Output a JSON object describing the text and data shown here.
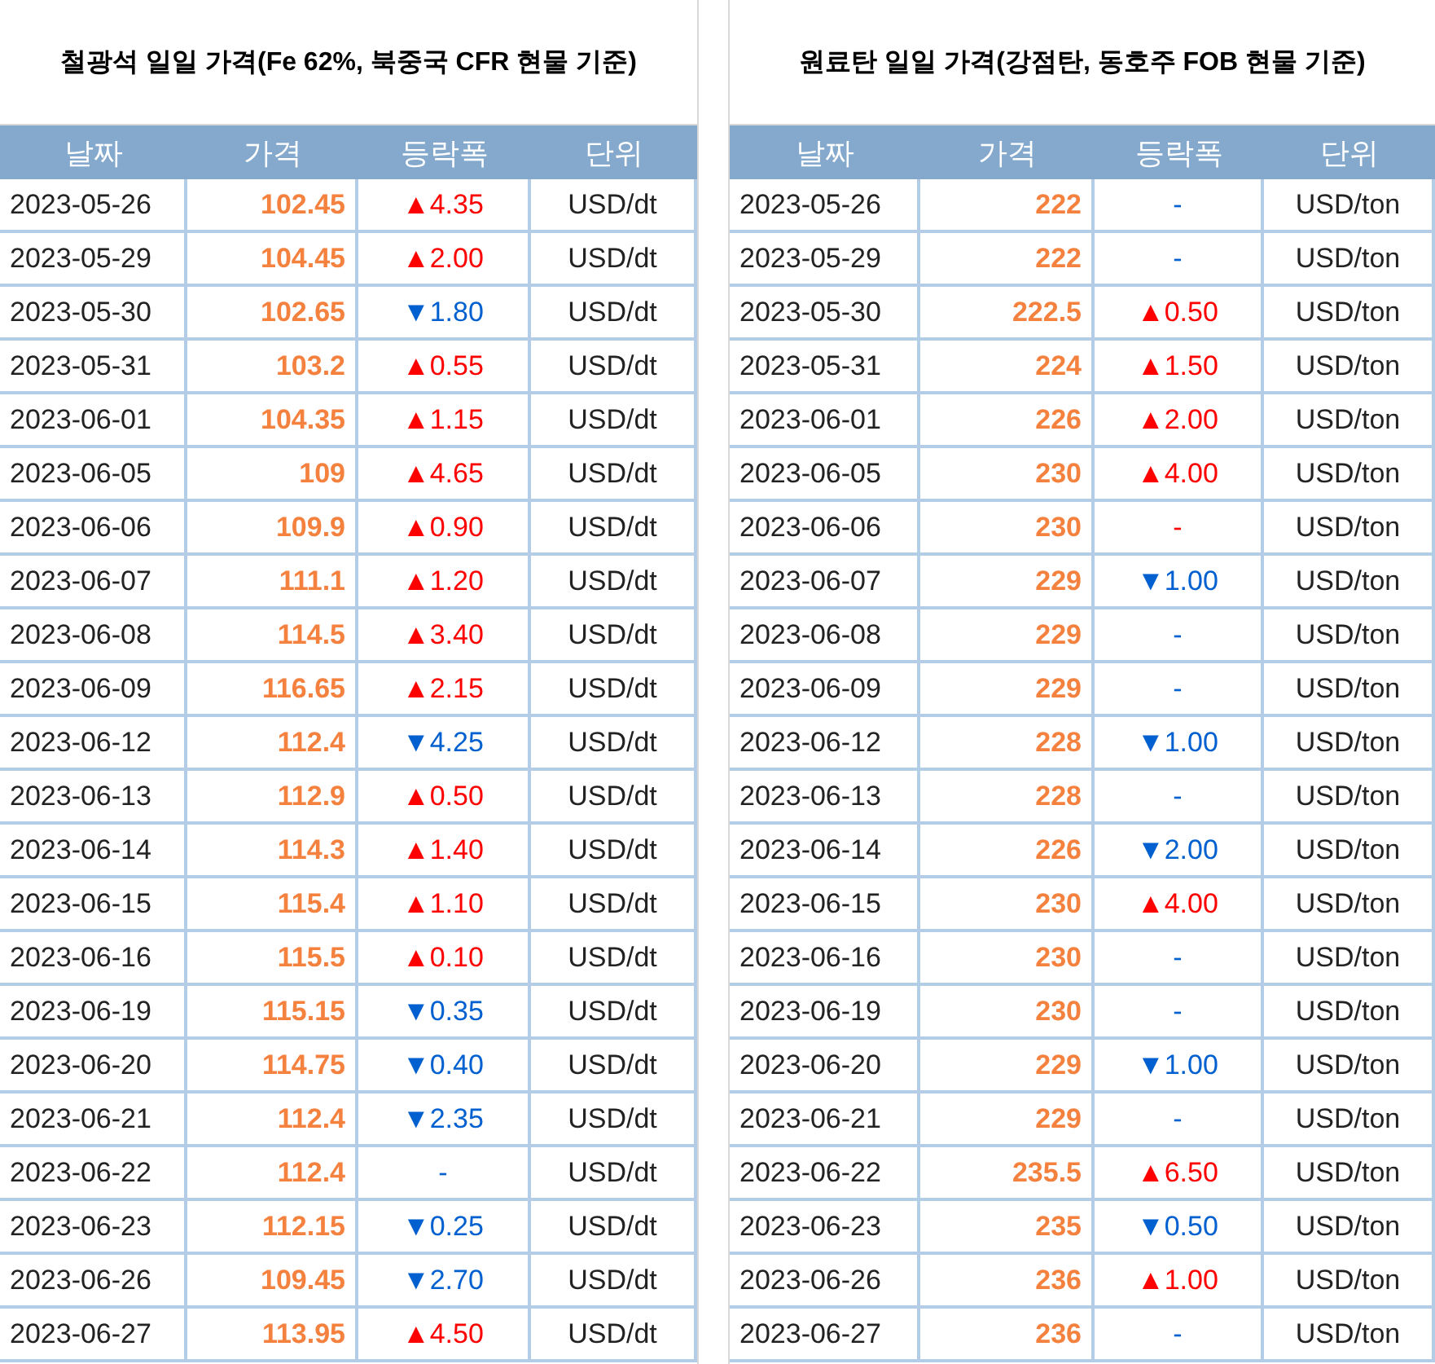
{
  "tables": [
    {
      "title": "철광석 일일 가격(Fe 62%, 북중국 CFR 현물 기준)",
      "columns": [
        "날짜",
        "가격",
        "등락폭",
        "단위"
      ],
      "rows": [
        {
          "date": "2023-05-26",
          "price": "102.45",
          "change": "▲4.35",
          "color": "#ff0000",
          "unit": "USD/dt"
        },
        {
          "date": "2023-05-29",
          "price": "104.45",
          "change": "▲2.00",
          "color": "#ff0000",
          "unit": "USD/dt"
        },
        {
          "date": "2023-05-30",
          "price": "102.65",
          "change": "▼1.80",
          "color": "#0060d0",
          "unit": "USD/dt"
        },
        {
          "date": "2023-05-31",
          "price": "103.2",
          "change": "▲0.55",
          "color": "#ff0000",
          "unit": "USD/dt"
        },
        {
          "date": "2023-06-01",
          "price": "104.35",
          "change": "▲1.15",
          "color": "#ff0000",
          "unit": "USD/dt"
        },
        {
          "date": "2023-06-05",
          "price": "109",
          "change": "▲4.65",
          "color": "#ff0000",
          "unit": "USD/dt"
        },
        {
          "date": "2023-06-06",
          "price": "109.9",
          "change": "▲0.90",
          "color": "#ff0000",
          "unit": "USD/dt"
        },
        {
          "date": "2023-06-07",
          "price": "111.1",
          "change": "▲1.20",
          "color": "#ff0000",
          "unit": "USD/dt"
        },
        {
          "date": "2023-06-08",
          "price": "114.5",
          "change": "▲3.40",
          "color": "#ff0000",
          "unit": "USD/dt"
        },
        {
          "date": "2023-06-09",
          "price": "116.65",
          "change": "▲2.15",
          "color": "#ff0000",
          "unit": "USD/dt"
        },
        {
          "date": "2023-06-12",
          "price": "112.4",
          "change": "▼4.25",
          "color": "#0060d0",
          "unit": "USD/dt"
        },
        {
          "date": "2023-06-13",
          "price": "112.9",
          "change": "▲0.50",
          "color": "#ff0000",
          "unit": "USD/dt"
        },
        {
          "date": "2023-06-14",
          "price": "114.3",
          "change": "▲1.40",
          "color": "#ff0000",
          "unit": "USD/dt"
        },
        {
          "date": "2023-06-15",
          "price": "115.4",
          "change": "▲1.10",
          "color": "#ff0000",
          "unit": "USD/dt"
        },
        {
          "date": "2023-06-16",
          "price": "115.5",
          "change": "▲0.10",
          "color": "#ff0000",
          "unit": "USD/dt"
        },
        {
          "date": "2023-06-19",
          "price": "115.15",
          "change": "▼0.35",
          "color": "#0060d0",
          "unit": "USD/dt"
        },
        {
          "date": "2023-06-20",
          "price": "114.75",
          "change": "▼0.40",
          "color": "#0060d0",
          "unit": "USD/dt"
        },
        {
          "date": "2023-06-21",
          "price": "112.4",
          "change": "▼2.35",
          "color": "#0060d0",
          "unit": "USD/dt"
        },
        {
          "date": "2023-06-22",
          "price": "112.4",
          "change": "-",
          "color": "#0060d0",
          "unit": "USD/dt"
        },
        {
          "date": "2023-06-23",
          "price": "112.15",
          "change": "▼0.25",
          "color": "#0060d0",
          "unit": "USD/dt"
        },
        {
          "date": "2023-06-26",
          "price": "109.45",
          "change": "▼2.70",
          "color": "#0060d0",
          "unit": "USD/dt"
        },
        {
          "date": "2023-06-27",
          "price": "113.95",
          "change": "▲4.50",
          "color": "#ff0000",
          "unit": "USD/dt"
        }
      ]
    },
    {
      "title": "원료탄 일일 가격(강점탄, 동호주 FOB 현물 기준)",
      "columns": [
        "날짜",
        "가격",
        "등락폭",
        "단위"
      ],
      "rows": [
        {
          "date": "2023-05-26",
          "price": "222",
          "change": "-",
          "color": "#0060d0",
          "unit": "USD/ton"
        },
        {
          "date": "2023-05-29",
          "price": "222",
          "change": "-",
          "color": "#0060d0",
          "unit": "USD/ton"
        },
        {
          "date": "2023-05-30",
          "price": "222.5",
          "change": "▲0.50",
          "color": "#ff0000",
          "unit": "USD/ton"
        },
        {
          "date": "2023-05-31",
          "price": "224",
          "change": "▲1.50",
          "color": "#ff0000",
          "unit": "USD/ton"
        },
        {
          "date": "2023-06-01",
          "price": "226",
          "change": "▲2.00",
          "color": "#ff0000",
          "unit": "USD/ton"
        },
        {
          "date": "2023-06-05",
          "price": "230",
          "change": "▲4.00",
          "color": "#ff0000",
          "unit": "USD/ton"
        },
        {
          "date": "2023-06-06",
          "price": "230",
          "change": "-",
          "color": "#ff0000",
          "unit": "USD/ton"
        },
        {
          "date": "2023-06-07",
          "price": "229",
          "change": "▼1.00",
          "color": "#0060d0",
          "unit": "USD/ton"
        },
        {
          "date": "2023-06-08",
          "price": "229",
          "change": "-",
          "color": "#0060d0",
          "unit": "USD/ton"
        },
        {
          "date": "2023-06-09",
          "price": "229",
          "change": "-",
          "color": "#0060d0",
          "unit": "USD/ton"
        },
        {
          "date": "2023-06-12",
          "price": "228",
          "change": "▼1.00",
          "color": "#0060d0",
          "unit": "USD/ton"
        },
        {
          "date": "2023-06-13",
          "price": "228",
          "change": "-",
          "color": "#0060d0",
          "unit": "USD/ton"
        },
        {
          "date": "2023-06-14",
          "price": "226",
          "change": "▼2.00",
          "color": "#0060d0",
          "unit": "USD/ton"
        },
        {
          "date": "2023-06-15",
          "price": "230",
          "change": "▲4.00",
          "color": "#ff0000",
          "unit": "USD/ton"
        },
        {
          "date": "2023-06-16",
          "price": "230",
          "change": "-",
          "color": "#0060d0",
          "unit": "USD/ton"
        },
        {
          "date": "2023-06-19",
          "price": "230",
          "change": "-",
          "color": "#0060d0",
          "unit": "USD/ton"
        },
        {
          "date": "2023-06-20",
          "price": "229",
          "change": "▼1.00",
          "color": "#0060d0",
          "unit": "USD/ton"
        },
        {
          "date": "2023-06-21",
          "price": "229",
          "change": "-",
          "color": "#0060d0",
          "unit": "USD/ton"
        },
        {
          "date": "2023-06-22",
          "price": "235.5",
          "change": "▲6.50",
          "color": "#ff0000",
          "unit": "USD/ton"
        },
        {
          "date": "2023-06-23",
          "price": "235",
          "change": "▼0.50",
          "color": "#0060d0",
          "unit": "USD/ton"
        },
        {
          "date": "2023-06-26",
          "price": "236",
          "change": "▲1.00",
          "color": "#ff0000",
          "unit": "USD/ton"
        },
        {
          "date": "2023-06-27",
          "price": "236",
          "change": "-",
          "color": "#0060d0",
          "unit": "USD/ton"
        }
      ]
    }
  ]
}
